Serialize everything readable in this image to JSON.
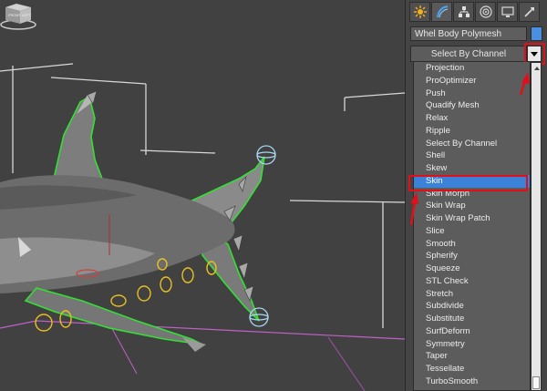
{
  "viewport": {
    "viewcube_label_left": "FRONT",
    "viewcube_label_right": "LEFT"
  },
  "command_panel": {
    "tabs": [
      "create-icon",
      "modify-icon",
      "hierarchy-icon",
      "motion-icon",
      "display-icon",
      "utilities-icon"
    ],
    "object_name": "Whel Body Polymesh",
    "object_color": "#4a8fe0",
    "modifier_dropdown": "Select By Channel",
    "modifier_list": [
      "Projection",
      "ProOptimizer",
      "Push",
      "Quadify Mesh",
      "Relax",
      "Ripple",
      "Select By Channel",
      "Shell",
      "Skew",
      "Skin",
      "Skin Morph",
      "Skin Wrap",
      "Skin Wrap Patch",
      "Slice",
      "Smooth",
      "Spherify",
      "Squeeze",
      "STL Check",
      "Stretch",
      "Subdivide",
      "Substitute",
      "SurfDeform",
      "Symmetry",
      "Taper",
      "Tessellate",
      "TurboSmooth"
    ],
    "selected_item": "Skin",
    "highlight_color": "#e0101a"
  }
}
